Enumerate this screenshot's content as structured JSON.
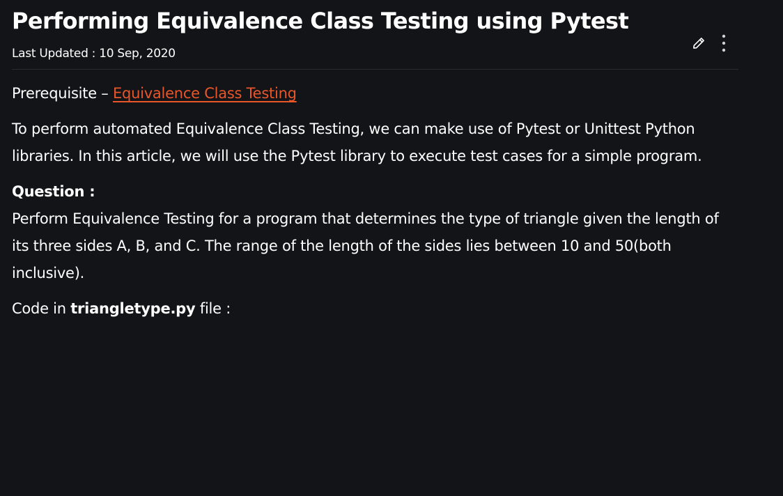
{
  "article": {
    "title": "Performing Equivalence Class Testing using Pytest",
    "last_updated_label": "Last Updated : ",
    "last_updated_date": "10 Sep, 2020",
    "prerequisite_label": "Prerequisite – ",
    "prerequisite_link": "Equivalence Class Testing",
    "intro": "To perform automated Equivalence Class Testing, we can make use of Pytest or Unittest Python libraries. In this article, we will use the Pytest library to execute test cases for a simple program.",
    "question_heading": "Question :",
    "question_text": "Perform Equivalence Testing for a program that determines the type of triangle given the length of its three sides A, B, and C. The range of the length of the sides lies between 10 and 50(both inclusive).",
    "code_prefix": "Code in ",
    "code_file": "triangletype.py",
    "code_suffix": " file :"
  },
  "icons": {
    "edit": "pencil-icon",
    "more": "more-vertical-icon"
  },
  "colors": {
    "background": "#131417",
    "text": "#ffffff",
    "link": "#e8562a",
    "divider": "#2a2c31"
  }
}
